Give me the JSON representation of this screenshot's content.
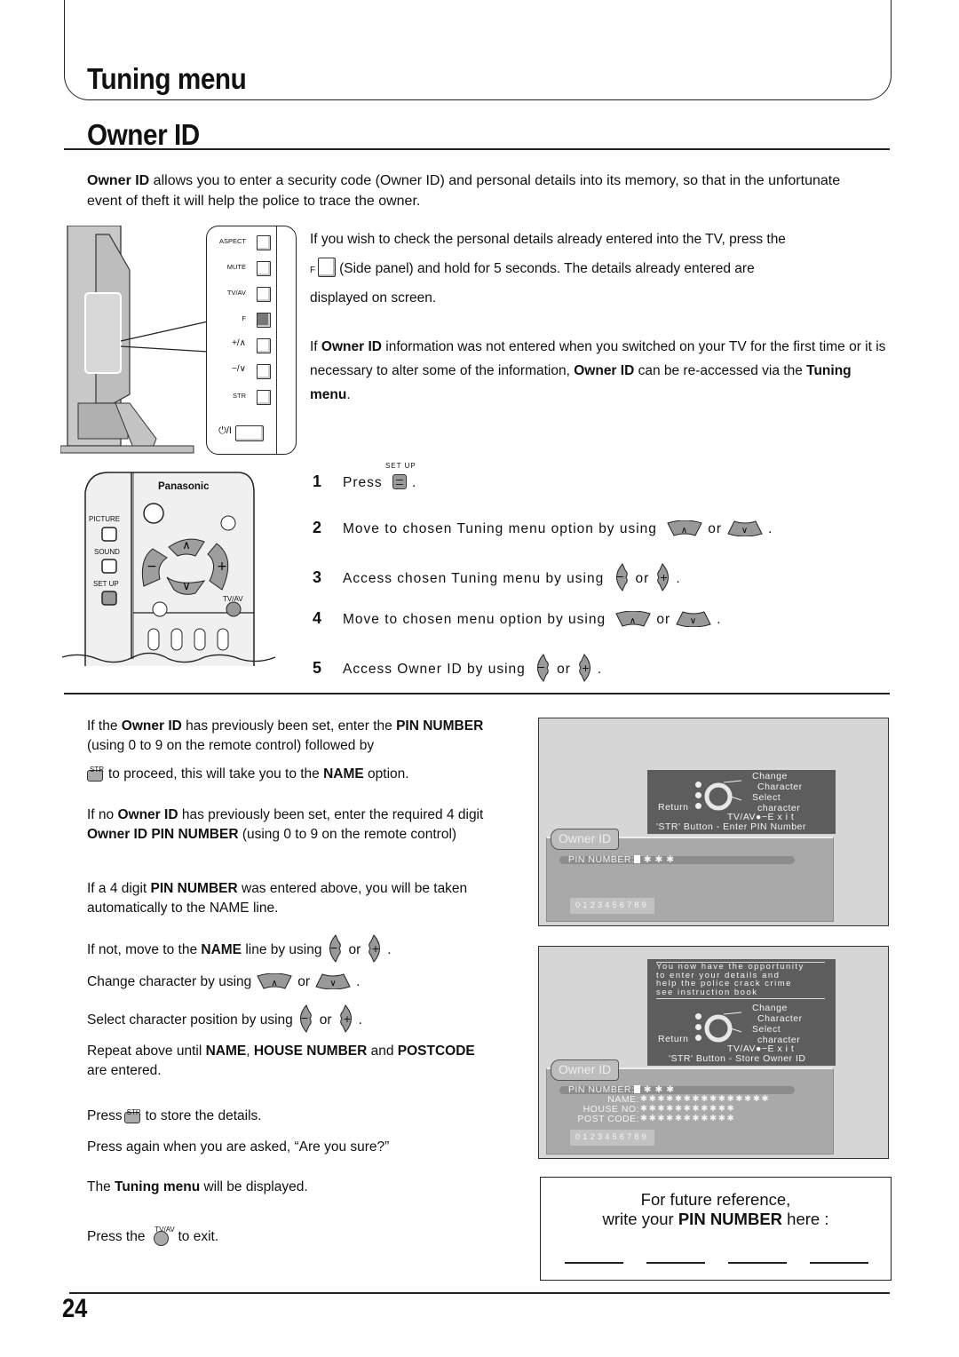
{
  "header": {
    "section_title": "Tuning menu",
    "page_title": "Owner ID"
  },
  "intro": {
    "bold_lead": "Owner ID",
    "text": " allows you to enter a security code (Owner ID) and personal details into its memory, so that in the unfortunate event of theft it will help the police to trace the owner."
  },
  "side_panel": {
    "buttons": [
      {
        "label": "ASPECT"
      },
      {
        "label": "MUTE"
      },
      {
        "label": "TV/AV"
      },
      {
        "label": "F"
      },
      {
        "label": "+/∧"
      },
      {
        "label": "−/∨"
      },
      {
        "label": "STR"
      }
    ],
    "power_label": "⏻/I"
  },
  "check_details": {
    "line1": "If you wish to check the personal details already entered into the TV, press the",
    "f_label": "F",
    "line2": "(Side panel) and hold for 5 seconds. The details already entered are",
    "line3": "displayed on screen."
  },
  "reaccess": {
    "p1": "If ",
    "b1": "Owner ID",
    "p2": " information was not entered when you switched on your TV for the first time or it is necessary to alter some of the information, ",
    "b2": "Owner ID",
    "p3": " can be re-accessed via the ",
    "b3": "Tuning menu",
    "p4": "."
  },
  "remote": {
    "brand": "Panasonic",
    "picture": "PICTURE",
    "sound": "SOUND",
    "setup": "SET UP",
    "tvav": "TV/AV"
  },
  "steps": [
    {
      "num": "1",
      "text": "Press",
      "icon_caption": "SET UP",
      "tail": "."
    },
    {
      "num": "2",
      "text": "Move to chosen Tuning menu option by using",
      "or": "or",
      "tail": "."
    },
    {
      "num": "3",
      "text": "Access chosen Tuning menu by using",
      "or": "or",
      "tail": "."
    },
    {
      "num": "4",
      "text": "Move to chosen menu option by using",
      "or": "or",
      "tail": "."
    },
    {
      "num": "5",
      "text": "Access Owner ID by using",
      "or": "or",
      "tail": "."
    }
  ],
  "instructions": {
    "pin_set": {
      "a": "If the ",
      "b1": "Owner ID",
      "c": " has previously been set, enter the ",
      "b2": "PIN NUMBER",
      "d": " (using 0 to 9 on the remote control) followed by",
      "str_caption": "STR",
      "e": "to proceed, this will take you to the ",
      "b3": "NAME",
      "f": " option."
    },
    "pin_new": {
      "a": "If no ",
      "b1": "Owner ID",
      "c": " has previously been set, enter the required 4 digit ",
      "b2": "Owner ID PIN NUMBER",
      "d": " (using 0 to 9 on the remote control)"
    },
    "pin_entered": {
      "a": "If a 4 digit ",
      "b1": "PIN NUMBER",
      "c": " was entered above, you will be taken automatically to the NAME line."
    },
    "move_name": {
      "a": "If not, move to the ",
      "b1": "NAME",
      "c": " line by using",
      "or": "or",
      "tail": "."
    },
    "change_char": {
      "a": "Change character by using",
      "or": "or",
      "tail": "."
    },
    "select_pos": {
      "a": "Select character position by using",
      "or": "or",
      "tail": "."
    },
    "repeat": {
      "a": "Repeat above until ",
      "b1": "NAME",
      "c": ", ",
      "b2": "HOUSE NUMBER",
      "d": " and ",
      "b3": "POSTCODE",
      "e": " are entered."
    },
    "store": {
      "a": "Press",
      "str_caption": "STR",
      "b": "to store the details."
    },
    "again": "Press again when you are asked, “Are you sure?”",
    "displayed": {
      "a": "The ",
      "b1": "Tuning menu",
      "c": " will be displayed."
    },
    "exit": {
      "a": "Press the",
      "tvav_caption": "TV/AV",
      "b": "to exit."
    }
  },
  "osd_screen_1": {
    "help": {
      "change": "Change",
      "character": "Character",
      "select": "Select",
      "character2": "character",
      "return": "Return",
      "exit": "TV/AV●−E x i t",
      "str_line": "'STR' Button - Enter PIN Number"
    },
    "tab": "Owner ID",
    "pin_label": "PIN NUMBER:",
    "pin_value": "✱ ✱ ✱",
    "digits": "0123456789"
  },
  "osd_screen_2": {
    "message": [
      "You now have the opportunity",
      "to enter your details and",
      "help the police crack crime",
      "see instruction book"
    ],
    "help": {
      "change": "Change",
      "character": "Character",
      "select": "Select",
      "character2": "character",
      "return": "Return",
      "exit": "TV/AV●−E x i t",
      "str_line": "'STR' Button - Store Owner ID"
    },
    "tab": "Owner ID",
    "fields": [
      {
        "label": "PIN NUMBER:",
        "value": "✱ ✱ ✱"
      },
      {
        "label": "NAME:",
        "value": "✱✱✱✱✱✱✱✱✱✱✱✱✱✱✱"
      },
      {
        "label": "HOUSE NO:",
        "value": "✱✱✱✱✱✱✱✱✱✱✱"
      },
      {
        "label": "POST CODE:",
        "value": "✱✱✱✱✱✱✱✱✱✱✱"
      }
    ],
    "digits": "0123456789"
  },
  "pin_note": {
    "line1": "For future reference,",
    "line2a": "write your ",
    "line2b": "PIN NUMBER",
    "line2c": " here :"
  },
  "footer": {
    "page_number": "24"
  }
}
